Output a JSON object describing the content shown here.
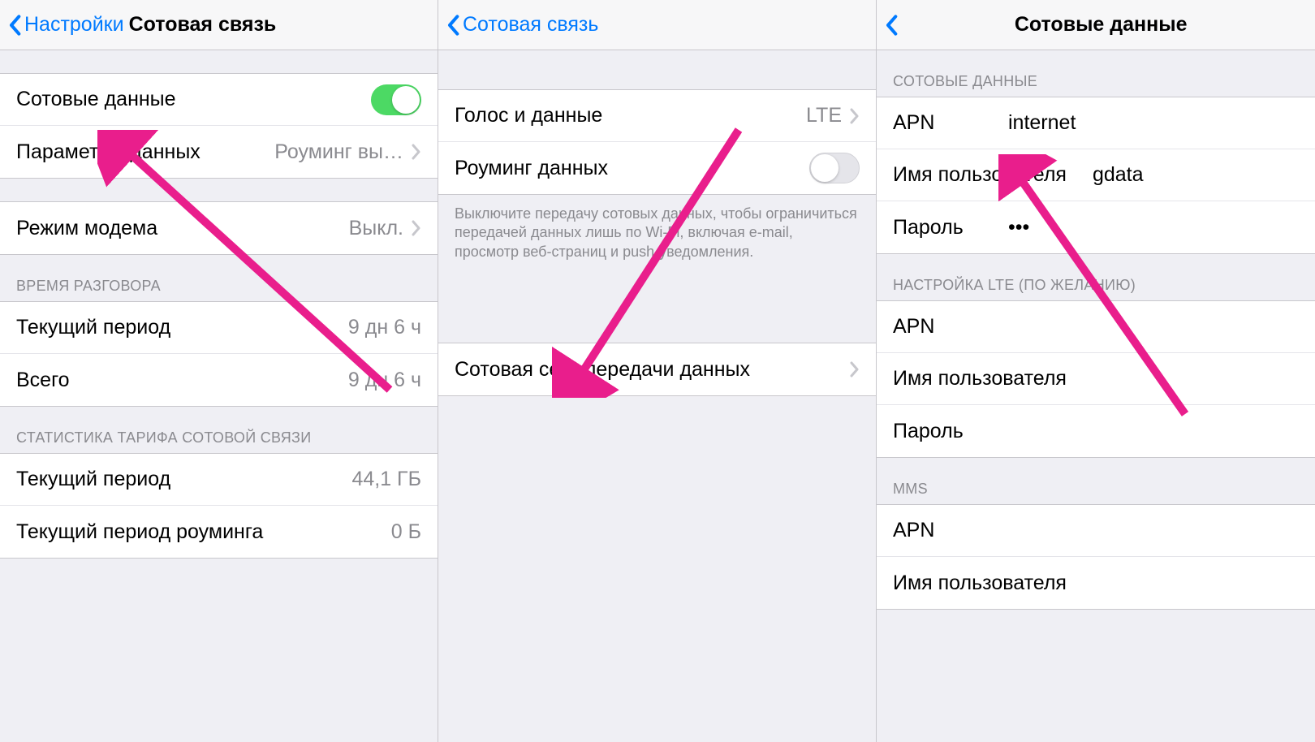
{
  "colors": {
    "accent": "#007aff",
    "toggle_on": "#4cd964",
    "arrow": "#e91e8c"
  },
  "panel1": {
    "back_label": "Настройки",
    "title": "Сотовая связь",
    "rows1": {
      "cellular_data": "Сотовые данные",
      "data_options_label": "Параметры данных",
      "data_options_value": "Роуминг вы…"
    },
    "rows2": {
      "hotspot_label": "Режим модема",
      "hotspot_value": "Выкл."
    },
    "section_talk": "ВРЕМЯ РАЗГОВОРА",
    "talk": {
      "current_label": "Текущий период",
      "current_value": "9 дн 6 ч",
      "total_label": "Всего",
      "total_value": "9 дн 6 ч"
    },
    "section_stats": "СТАТИСТИКА ТАРИФА СОТОВОЙ СВЯЗИ",
    "stats": {
      "current_label": "Текущий период",
      "current_value": "44,1 ГБ",
      "roaming_label": "Текущий период роуминга",
      "roaming_value": "0 Б"
    }
  },
  "panel2": {
    "back_label": "Сотовая связь",
    "rows1": {
      "voice_label": "Голос и данные",
      "voice_value": "LTE",
      "roaming_label": "Роуминг данных"
    },
    "note": "Выключите передачу сотовых данных, чтобы ограничиться передачей данных лишь по Wi-Fi, включая e-mail, просмотр веб-страниц и push-уведомления.",
    "rows2": {
      "network_label": "Сотовая сеть передачи данных"
    }
  },
  "panel3": {
    "title": "Сотовые данные",
    "section1": "СОТОВЫЕ ДАННЫЕ",
    "cellular": {
      "apn_label": "APN",
      "apn_value": "internet",
      "user_label": "Имя пользователя",
      "user_value": "gdata",
      "pass_label": "Пароль",
      "pass_value": "•••"
    },
    "section2": "НАСТРОЙКА LTE (ПО ЖЕЛАНИЮ)",
    "lte": {
      "apn_label": "APN",
      "user_label": "Имя пользователя",
      "pass_label": "Пароль"
    },
    "section3": "MMS",
    "mms": {
      "apn_label": "APN",
      "user_label": "Имя пользователя"
    }
  }
}
